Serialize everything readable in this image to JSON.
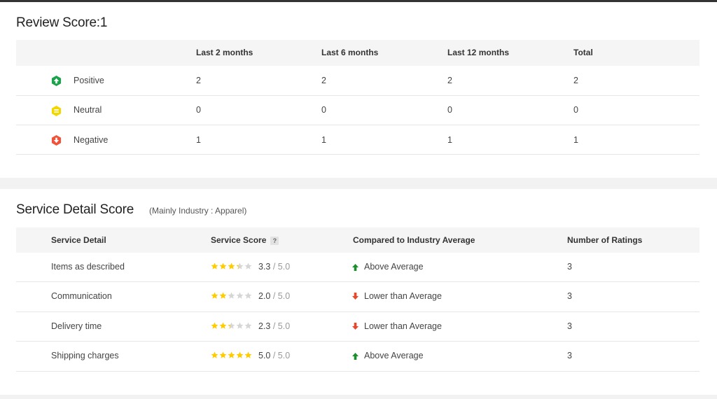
{
  "review": {
    "title": "Review Score:1",
    "columns": [
      "Last 2 months",
      "Last 6 months",
      "Last 12 months",
      "Total"
    ],
    "rows": [
      {
        "label": "Positive",
        "icon": "positive-arrow-up-icon",
        "values": [
          "2",
          "2",
          "2",
          "2"
        ]
      },
      {
        "label": "Neutral",
        "icon": "neutral-equals-icon",
        "values": [
          "0",
          "0",
          "0",
          "0"
        ]
      },
      {
        "label": "Negative",
        "icon": "negative-arrow-down-icon",
        "values": [
          "1",
          "1",
          "1",
          "1"
        ]
      }
    ]
  },
  "service": {
    "title": "Service Detail Score",
    "subtitle": "(Mainly Industry : Apparel)",
    "columns": [
      "Service Detail",
      "Service Score",
      "Compared to Industry Average",
      "Number of Ratings"
    ],
    "help_label": "?",
    "rows": [
      {
        "label": "Items as described",
        "score": "3.3",
        "max": " / 5.0",
        "rating": 3.3,
        "comparison": "Above Average",
        "trend": "up",
        "count": "3"
      },
      {
        "label": "Communication",
        "score": "2.0",
        "max": " / 5.0",
        "rating": 2.0,
        "comparison": "Lower than Average",
        "trend": "down",
        "count": "3"
      },
      {
        "label": "Delivery time",
        "score": "2.3",
        "max": " / 5.0",
        "rating": 2.3,
        "comparison": "Lower than Average",
        "trend": "down",
        "count": "3"
      },
      {
        "label": "Shipping charges",
        "score": "5.0",
        "max": " / 5.0",
        "rating": 5.0,
        "comparison": "Above Average",
        "trend": "up",
        "count": "3"
      }
    ]
  },
  "colors": {
    "positive": "#1aa34a",
    "neutral": "#f2d600",
    "negative": "#f0533a",
    "star": "#ffcc00",
    "star_empty": "#d6d6d6",
    "arrow_up": "#1a8f2c",
    "arrow_down": "#e8472e"
  }
}
